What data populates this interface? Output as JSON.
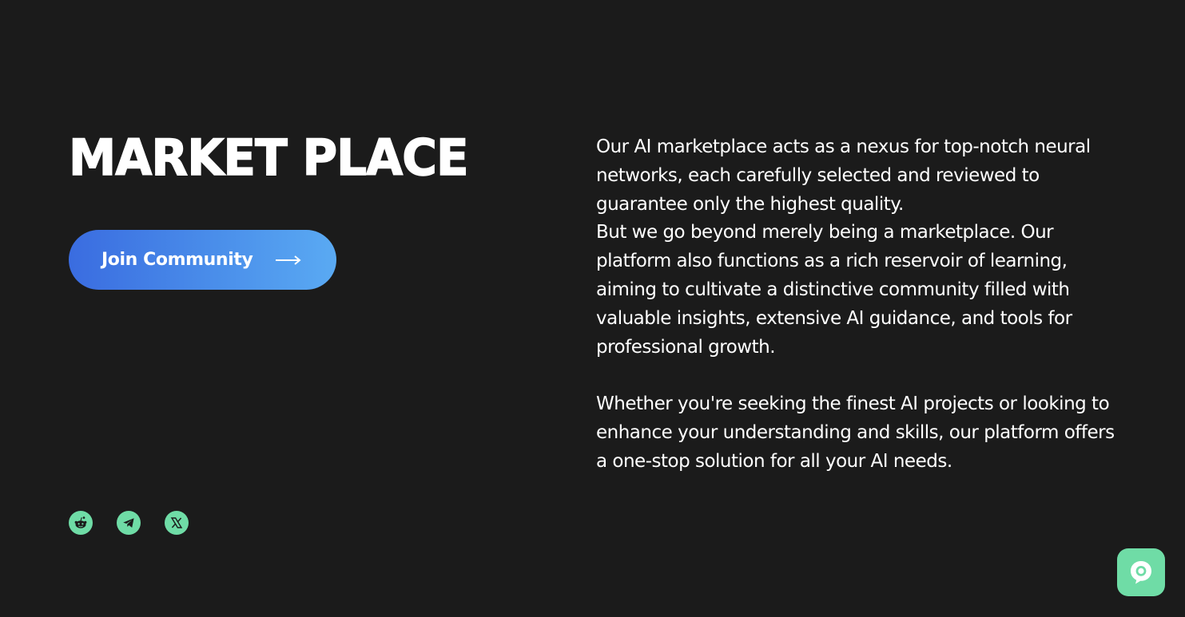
{
  "hero": {
    "title": "MARKET PLACE",
    "join_button_label": "Join Community",
    "arrow_icon": "arrow-right-icon"
  },
  "description": {
    "paragraph_1_sentence_1": "Our AI marketplace acts as a nexus for top-notch neural networks, each carefully selected and reviewed to guarantee only the highest quality.",
    "paragraph_1_sentence_2": "But we go beyond merely being a marketplace. Our platform also functions as a rich reservoir of learning, aiming to cultivate a distinctive community filled with valuable insights, extensive AI guidance, and tools for professional growth.",
    "paragraph_2": "Whether you're seeking the finest AI projects or looking to enhance your understanding and skills, our platform offers a one-stop solution for all your AI needs."
  },
  "socials": [
    {
      "icon": "reddit-icon"
    },
    {
      "icon": "telegram-icon"
    },
    {
      "icon": "x-icon"
    }
  ],
  "chat_widget": {
    "icon": "chat-bubble-icon"
  },
  "colors": {
    "background": "#1b1b1b",
    "text": "#ffffff",
    "accent_green": "#6fdca6",
    "button_gradient_start": "#3a6ce0",
    "button_gradient_end": "#5aaaf3"
  }
}
